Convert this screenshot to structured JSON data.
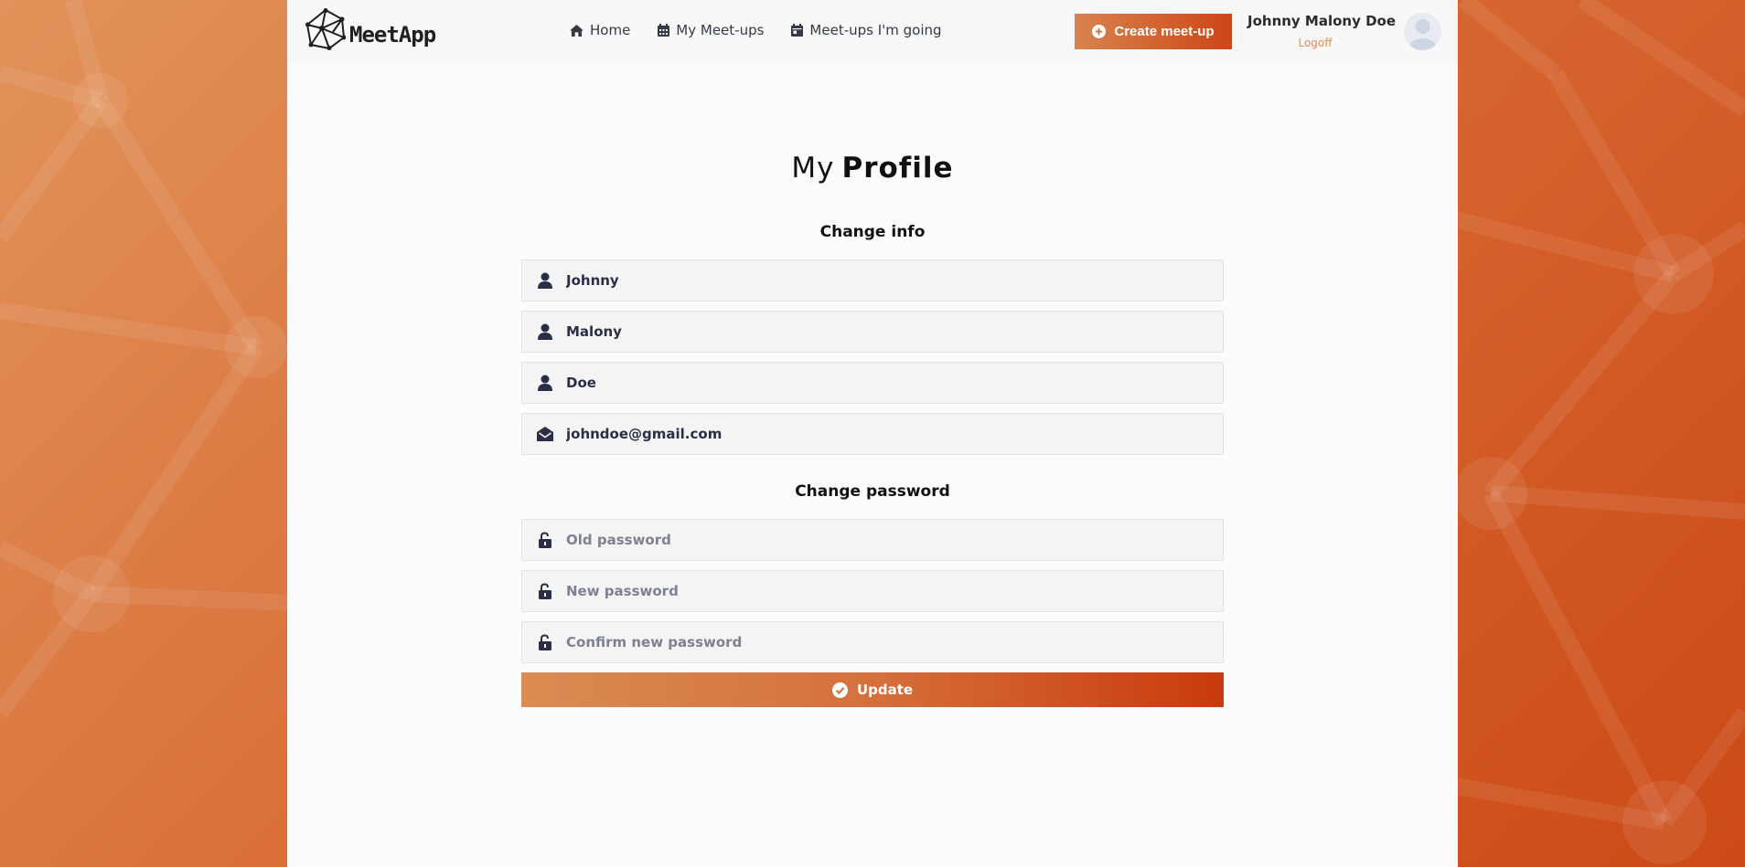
{
  "brand": {
    "name": "MeetApp"
  },
  "nav": {
    "items": [
      {
        "label": "Home",
        "icon": "home-icon"
      },
      {
        "label": "My Meet-ups",
        "icon": "calendar-icon"
      },
      {
        "label": "Meet-ups I'm going",
        "icon": "calendar-day-icon"
      }
    ]
  },
  "header": {
    "create_label": "Create meet-up",
    "user_name": "Johnny Malony Doe",
    "logoff_label": "Logoff"
  },
  "page": {
    "title_light": "My",
    "title_bold": "Profile"
  },
  "info": {
    "heading": "Change info",
    "first_name": "Johnny",
    "middle_name": "Malony",
    "last_name": "Doe",
    "email": "johndoe@gmail.com"
  },
  "password": {
    "heading": "Change password",
    "old_placeholder": "Old password",
    "new_placeholder": "New password",
    "confirm_placeholder": "Confirm new password"
  },
  "actions": {
    "update_label": "Update"
  },
  "colors": {
    "accent_start": "#d98c53",
    "accent_end": "#c93a0c",
    "logoff": "#dd8d55",
    "icon": "#2b2f45"
  }
}
